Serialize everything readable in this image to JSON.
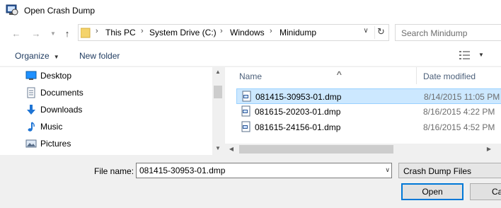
{
  "window": {
    "title": "Open Crash Dump",
    "icon": "crash-dump-app-icon"
  },
  "nav": {
    "back_icon": "back-arrow-icon",
    "forward_icon": "forward-arrow-icon",
    "up_icon": "up-arrow-icon",
    "breadcrumb": [
      "This PC",
      "System Drive (C:)",
      "Windows",
      "Minidump"
    ],
    "search_placeholder": "Search Minidump"
  },
  "toolbar": {
    "organize_label": "Organize",
    "new_folder_label": "New folder",
    "view_icon": "view-options-icon"
  },
  "sidebar": {
    "items": [
      {
        "label": "Desktop",
        "icon": "desktop-icon"
      },
      {
        "label": "Documents",
        "icon": "documents-icon"
      },
      {
        "label": "Downloads",
        "icon": "downloads-icon"
      },
      {
        "label": "Music",
        "icon": "music-icon"
      },
      {
        "label": "Pictures",
        "icon": "pictures-icon"
      }
    ]
  },
  "files": {
    "columns": {
      "name": "Name",
      "date": "Date modified"
    },
    "rows": [
      {
        "name": "081415-30953-01.dmp",
        "date": "8/14/2015 11:05 PM",
        "selected": true
      },
      {
        "name": "081615-20203-01.dmp",
        "date": "8/16/2015 4:22 PM",
        "selected": false
      },
      {
        "name": "081615-24156-01.dmp",
        "date": "8/16/2015 4:52 PM",
        "selected": false
      }
    ]
  },
  "footer": {
    "file_name_label": "File name:",
    "file_name_value": "081415-30953-01.dmp",
    "filter_value": "Crash Dump Files",
    "open_label": "Open",
    "cancel_label": "Cancel"
  },
  "colors": {
    "selection_bg": "#cce8ff",
    "selection_border": "#99d1ff",
    "accent": "#0078d7"
  }
}
